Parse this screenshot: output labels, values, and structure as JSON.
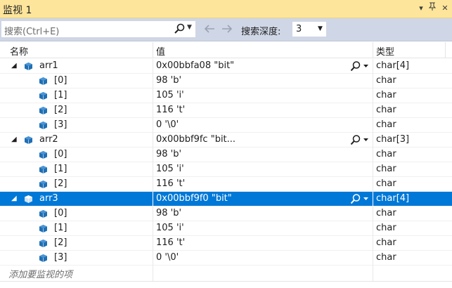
{
  "window": {
    "title": "监视 1"
  },
  "toolbar": {
    "search_placeholder": "搜索(Ctrl+E)",
    "depth_label": "搜索深度:",
    "depth_value": "3"
  },
  "columns": {
    "name": "名称",
    "value": "值",
    "type": "类型"
  },
  "rows": [
    {
      "name": "arr1",
      "value": "0x00bbfa08 \"bit\"",
      "type": "char[4]",
      "level": 0,
      "expanded": true,
      "has_actions": true,
      "selected": false
    },
    {
      "name": "[0]",
      "value": "98 'b'",
      "type": "char",
      "level": 1
    },
    {
      "name": "[1]",
      "value": "105 'i'",
      "type": "char",
      "level": 1
    },
    {
      "name": "[2]",
      "value": "116 't'",
      "type": "char",
      "level": 1
    },
    {
      "name": "[3]",
      "value": "0 '\\0'",
      "type": "char",
      "level": 1
    },
    {
      "name": "arr2",
      "value": "0x00bbf9fc \"bit...",
      "type": "char[3]",
      "level": 0,
      "expanded": true,
      "has_actions": true,
      "selected": false
    },
    {
      "name": "[0]",
      "value": "98 'b'",
      "type": "char",
      "level": 1
    },
    {
      "name": "[1]",
      "value": "105 'i'",
      "type": "char",
      "level": 1
    },
    {
      "name": "[2]",
      "value": "116 't'",
      "type": "char",
      "level": 1
    },
    {
      "name": "arr3",
      "value": "0x00bbf9f0 \"bit\"",
      "type": "char[4]",
      "level": 0,
      "expanded": true,
      "has_actions": true,
      "selected": true
    },
    {
      "name": "[0]",
      "value": "98 'b'",
      "type": "char",
      "level": 1
    },
    {
      "name": "[1]",
      "value": "105 'i'",
      "type": "char",
      "level": 1
    },
    {
      "name": "[2]",
      "value": "116 't'",
      "type": "char",
      "level": 1
    },
    {
      "name": "[3]",
      "value": "0 '\\0'",
      "type": "char",
      "level": 1
    }
  ],
  "add_watch_placeholder": "添加要监视的项",
  "colors": {
    "title_bar": "#fde59b",
    "toolbar": "#cfd6e5",
    "selection": "#0078d7",
    "cube": "#1f6fb5"
  },
  "icons": [
    "pin-icon",
    "close-icon",
    "dropdown-icon",
    "search-icon",
    "back-arrow-icon",
    "forward-arrow-icon",
    "expand-triangle-icon",
    "variable-cube-icon",
    "magnifier-icon"
  ]
}
